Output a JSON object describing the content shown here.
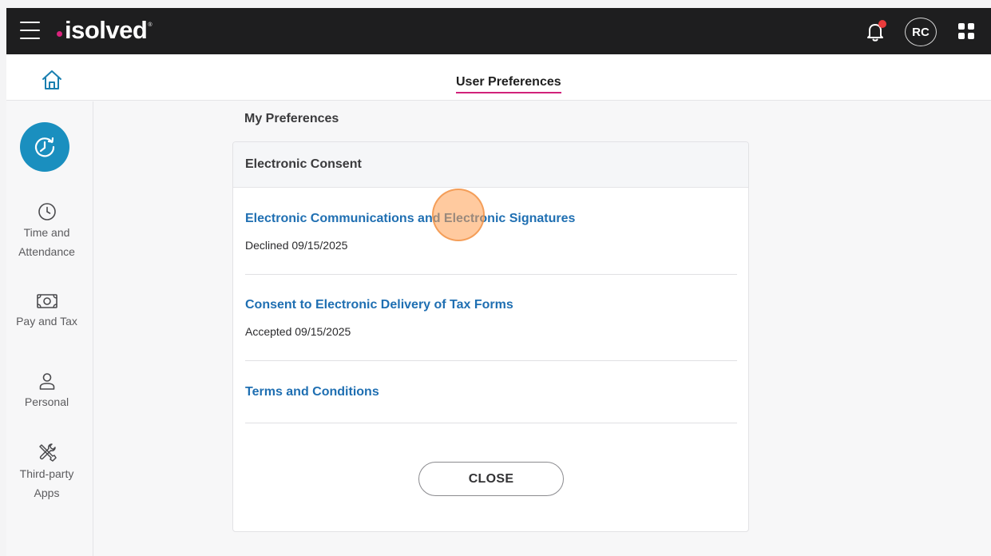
{
  "topbar": {
    "brand": "isolved",
    "brand_tm": "®",
    "avatar_initials": "RC",
    "icons": {
      "menu": "hamburger-menu-icon",
      "notifications": "bell-icon",
      "apps": "apps-grid-icon"
    },
    "colors": {
      "bar": "#1e1e1f",
      "brand_dot": "#d9237c",
      "notification_dot": "#ea3b3b"
    }
  },
  "subheader": {
    "home_icon": "home-icon",
    "title": "User Preferences",
    "title_underline_color": "#d1227a"
  },
  "sidebar": {
    "primary_icon": "clock-history-icon",
    "primary_color": "#1a8fbf",
    "items": [
      {
        "line1": "Time and",
        "line2": "Attendance",
        "icon": "clock-icon"
      },
      {
        "line1": "Pay and Tax",
        "line2": "",
        "icon": "money-icon"
      },
      {
        "line1": "Personal",
        "line2": "",
        "icon": "person-icon"
      },
      {
        "line1": "Third-party",
        "line2": "Apps",
        "icon": "tools-icon"
      }
    ]
  },
  "main": {
    "section_title": "My Preferences",
    "card": {
      "header": "Electronic Consent",
      "items": [
        {
          "link": "Electronic Communications and Electronic Signatures",
          "status": "Declined 09/15/2025"
        },
        {
          "link": "Consent to Electronic Delivery of Tax Forms",
          "status": "Accepted 09/15/2025"
        },
        {
          "link": "Terms and Conditions",
          "status": ""
        }
      ],
      "close_label": "CLOSE",
      "link_color": "#1f6fb2"
    }
  }
}
